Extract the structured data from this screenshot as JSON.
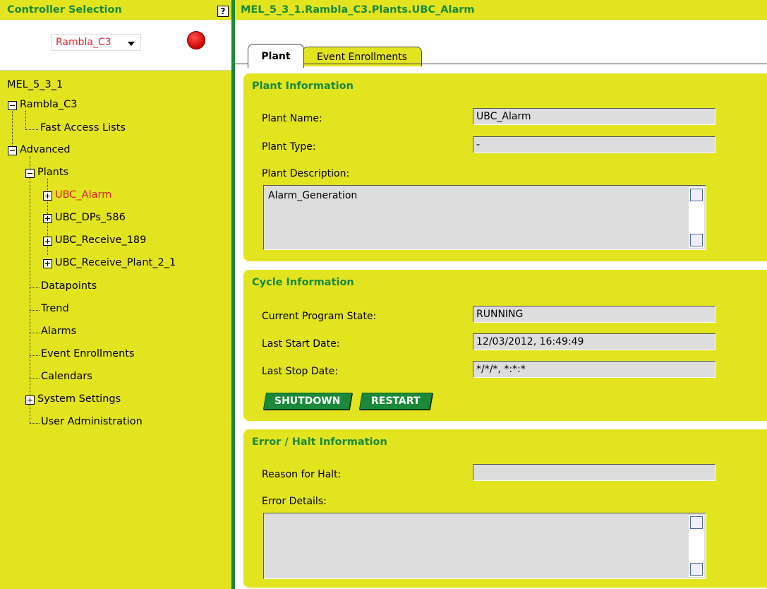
{
  "left": {
    "title": "Controller Selection",
    "help_label": "?",
    "controller_select": {
      "value": "Rambla_C3"
    },
    "status_color": "#e0222a",
    "tree": {
      "root": "MEL_5_3_1",
      "rambla": "Rambla_C3",
      "fast_access": "Fast Access Lists",
      "advanced": "Advanced",
      "plants": "Plants",
      "ubc_alarm": "UBC_Alarm",
      "ubc_dps": "UBC_DPs_586",
      "ubc_receive": "UBC_Receive_189",
      "ubc_receive_plant": "UBC_Receive_Plant_2_1",
      "datapoints": "Datapoints",
      "trend": "Trend",
      "alarms": "Alarms",
      "event_enrollments": "Event Enrollments",
      "calendars": "Calendars",
      "system_settings": "System Settings",
      "user_admin": "User Administration"
    }
  },
  "right": {
    "breadcrumb": "MEL_5_3_1.Rambla_C3.Plants.UBC_Alarm",
    "tabs": [
      {
        "label": "Plant",
        "active": true
      },
      {
        "label": "Event Enrollments",
        "active": false
      }
    ],
    "plant_info": {
      "title": "Plant Information",
      "name_label": "Plant Name:",
      "name_value": "UBC_Alarm",
      "type_label": "Plant Type:",
      "type_value": "-",
      "desc_label": "Plant Description:",
      "desc_value": "Alarm_Generation"
    },
    "cycle_info": {
      "title": "Cycle Information",
      "state_label": "Current Program State:",
      "state_value": "RUNNING",
      "start_label": "Last Start Date:",
      "start_value": "12/03/2012, 16:49:49",
      "stop_label": "Last Stop Date:",
      "stop_value": "*/*/*, *:*:*",
      "shutdown_label": "SHUTDOWN",
      "restart_label": "RESTART"
    },
    "error_info": {
      "title": "Error / Halt Information",
      "reason_label": "Reason for Halt:",
      "reason_value": "",
      "details_label": "Error Details:",
      "details_value": ""
    }
  },
  "colors": {
    "accent_yellow": "#e2e420",
    "brand_green": "#1a8a3a",
    "selected_red": "#e0222a"
  }
}
